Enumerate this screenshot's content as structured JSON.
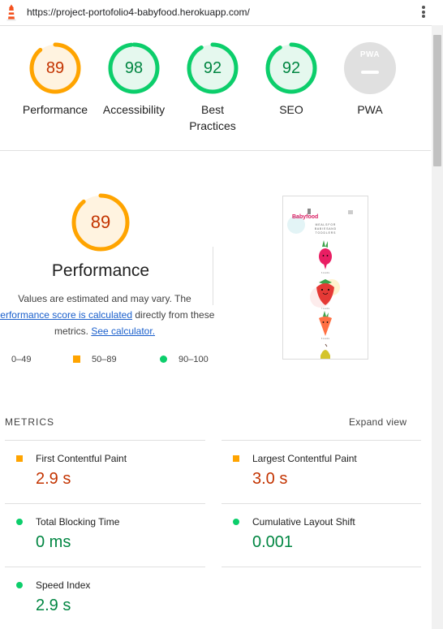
{
  "browser": {
    "url": "https://project-portofolio4-babyfood.herokuapp.com/"
  },
  "colors": {
    "average": "#ffa400",
    "pass": "#0cce6b",
    "na": "#e0e0e0"
  },
  "categories": [
    {
      "id": "performance",
      "score": "89",
      "label": "Performance",
      "status": "average"
    },
    {
      "id": "accessibility",
      "score": "98",
      "label": "Accessibility",
      "status": "pass"
    },
    {
      "id": "best-practices",
      "score": "92",
      "label_line1": "Best",
      "label_line2": "Practices",
      "status": "pass"
    },
    {
      "id": "seo",
      "score": "92",
      "label": "SEO",
      "status": "pass"
    },
    {
      "id": "pwa",
      "badge": "PWA",
      "label": "PWA",
      "status": "na"
    }
  ],
  "performance_section": {
    "score": "89",
    "title": "Performance",
    "desc_text1": "Values are estimated and may vary. The ",
    "desc_link1": "performance score is calculated",
    "desc_text2": " directly from these metrics. ",
    "desc_link2": "See calculator.",
    "legend": {
      "fail": "0–49",
      "average": "50–89",
      "pass": "90–100"
    }
  },
  "thumbnail": {
    "brand": "Babyfood",
    "tagline_line1": "M E A L S   F O R",
    "tagline_line2": "B A B I E S   A N D",
    "tagline_line3": "T O D D L E R S",
    "age1": "6 months",
    "age2": "7 months",
    "age3": "8 months"
  },
  "metrics": {
    "header": "METRICS",
    "expand_label": "Expand view",
    "fcp": {
      "title": "First Contentful Paint",
      "value": "2.9 s",
      "status": "average"
    },
    "lcp": {
      "title": "Largest Contentful Paint",
      "value": "3.0 s",
      "status": "average"
    },
    "tbt": {
      "title": "Total Blocking Time",
      "value": "0 ms",
      "status": "pass"
    },
    "cls": {
      "title": "Cumulative Layout Shift",
      "value": "0.001",
      "status": "pass"
    },
    "si": {
      "title": "Speed Index",
      "value": "2.9 s",
      "status": "pass"
    }
  }
}
